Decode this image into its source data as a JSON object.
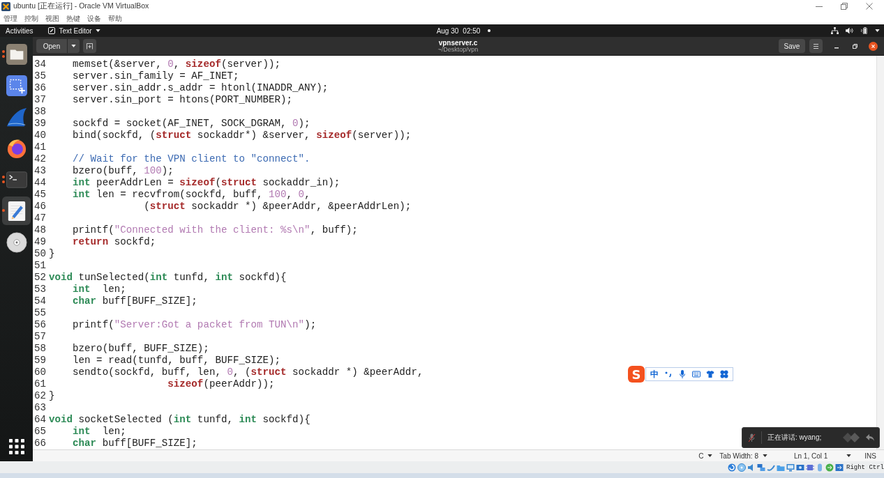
{
  "window": {
    "title": "ubuntu [正在运行] - Oracle VM VirtualBox"
  },
  "menu": [
    "管理",
    "控制",
    "视图",
    "热键",
    "设备",
    "帮助"
  ],
  "top_bar": {
    "activities": "Activities",
    "app_menu": "Text Editor",
    "date": "Aug 30",
    "time": "02:50",
    "unread_notification": true
  },
  "dock": {
    "items": [
      {
        "kind": "files",
        "running": true,
        "multiple_windows": true,
        "selected": false
      },
      {
        "kind": "screenshot",
        "running": false,
        "multiple_windows": false,
        "selected": false
      },
      {
        "kind": "wireshark",
        "running": false,
        "multiple_windows": false,
        "selected": false
      },
      {
        "kind": "firefox",
        "running": false,
        "multiple_windows": false,
        "selected": false
      },
      {
        "kind": "terminal",
        "running": true,
        "multiple_windows": true,
        "selected": false
      },
      {
        "kind": "editor",
        "running": true,
        "multiple_windows": false,
        "selected": true
      },
      {
        "kind": "disc",
        "running": false,
        "multiple_windows": false,
        "selected": false
      }
    ]
  },
  "editor": {
    "open_button": "Open",
    "file_name": "vpnserver.c",
    "file_path": "~/Desktop/vpn",
    "save_button": "Save",
    "lines": [
      {
        "number": "34",
        "tokens": [
          {
            "kind": "plain",
            "text": "    memset(&server, "
          },
          {
            "kind": "number",
            "text": "0"
          },
          {
            "kind": "plain",
            "text": ", "
          },
          {
            "kind": "keyword",
            "text": "sizeof"
          },
          {
            "kind": "plain",
            "text": "(server));"
          }
        ]
      },
      {
        "number": "35",
        "tokens": [
          {
            "kind": "plain",
            "text": "    server.sin_family = AF_INET;"
          }
        ]
      },
      {
        "number": "36",
        "tokens": [
          {
            "kind": "plain",
            "text": "    server.sin_addr.s_addr = htonl(INADDR_ANY);"
          }
        ]
      },
      {
        "number": "37",
        "tokens": [
          {
            "kind": "plain",
            "text": "    server.sin_port = htons(PORT_NUMBER);"
          }
        ]
      },
      {
        "number": "38"
      },
      {
        "number": "39",
        "tokens": [
          {
            "kind": "plain",
            "text": "    sockfd = socket(AF_INET, SOCK_DGRAM, "
          },
          {
            "kind": "number",
            "text": "0"
          },
          {
            "kind": "plain",
            "text": ");"
          }
        ]
      },
      {
        "number": "40",
        "tokens": [
          {
            "kind": "plain",
            "text": "    bind(sockfd, ("
          },
          {
            "kind": "keyword",
            "text": "struct"
          },
          {
            "kind": "plain",
            "text": " sockaddr*) &server, "
          },
          {
            "kind": "keyword",
            "text": "sizeof"
          },
          {
            "kind": "plain",
            "text": "(server));"
          }
        ]
      },
      {
        "number": "41"
      },
      {
        "number": "42",
        "tokens": [
          {
            "kind": "comment",
            "text": "    // Wait for the VPN client to \"connect\"."
          }
        ]
      },
      {
        "number": "43",
        "tokens": [
          {
            "kind": "plain",
            "text": "    bzero(buff, "
          },
          {
            "kind": "number",
            "text": "100"
          },
          {
            "kind": "plain",
            "text": ");"
          }
        ]
      },
      {
        "number": "44",
        "tokens": [
          {
            "kind": "type",
            "text": "    int"
          },
          {
            "kind": "plain",
            "text": " peerAddrLen = "
          },
          {
            "kind": "keyword",
            "text": "sizeof"
          },
          {
            "kind": "plain",
            "text": "("
          },
          {
            "kind": "keyword",
            "text": "struct"
          },
          {
            "kind": "plain",
            "text": " sockaddr_in);"
          }
        ]
      },
      {
        "number": "45",
        "tokens": [
          {
            "kind": "type",
            "text": "    int"
          },
          {
            "kind": "plain",
            "text": " len = recvfrom(sockfd, buff, "
          },
          {
            "kind": "number",
            "text": "100"
          },
          {
            "kind": "plain",
            "text": ", "
          },
          {
            "kind": "number",
            "text": "0"
          },
          {
            "kind": "plain",
            "text": ","
          }
        ]
      },
      {
        "number": "46",
        "tokens": [
          {
            "kind": "plain",
            "text": "                ("
          },
          {
            "kind": "keyword",
            "text": "struct"
          },
          {
            "kind": "plain",
            "text": " sockaddr *) &peerAddr, &peerAddrLen);"
          }
        ]
      },
      {
        "number": "47"
      },
      {
        "number": "48",
        "tokens": [
          {
            "kind": "plain",
            "text": "    printf("
          },
          {
            "kind": "string",
            "text": "\"Connected with the client: %s\\n\""
          },
          {
            "kind": "plain",
            "text": ", buff);"
          }
        ]
      },
      {
        "number": "49",
        "tokens": [
          {
            "kind": "keyword",
            "text": "    return"
          },
          {
            "kind": "plain",
            "text": " sockfd;"
          }
        ]
      },
      {
        "number": "50",
        "tokens": [
          {
            "kind": "plain",
            "text": "}"
          }
        ]
      },
      {
        "number": "51"
      },
      {
        "number": "52",
        "tokens": [
          {
            "kind": "type",
            "text": "void"
          },
          {
            "kind": "plain",
            "text": " tunSelected("
          },
          {
            "kind": "type",
            "text": "int"
          },
          {
            "kind": "plain",
            "text": " tunfd, "
          },
          {
            "kind": "type",
            "text": "int"
          },
          {
            "kind": "plain",
            "text": " sockfd){"
          }
        ]
      },
      {
        "number": "53",
        "tokens": [
          {
            "kind": "type",
            "text": "    int"
          },
          {
            "kind": "plain",
            "text": "  len;"
          }
        ]
      },
      {
        "number": "54",
        "tokens": [
          {
            "kind": "type",
            "text": "    char"
          },
          {
            "kind": "plain",
            "text": " buff[BUFF_SIZE];"
          }
        ]
      },
      {
        "number": "55"
      },
      {
        "number": "56",
        "tokens": [
          {
            "kind": "plain",
            "text": "    printf("
          },
          {
            "kind": "string",
            "text": "\"Server:Got a packet from TUN\\n\""
          },
          {
            "kind": "plain",
            "text": ");"
          }
        ]
      },
      {
        "number": "57"
      },
      {
        "number": "58",
        "tokens": [
          {
            "kind": "plain",
            "text": "    bzero(buff, BUFF_SIZE);"
          }
        ]
      },
      {
        "number": "59",
        "tokens": [
          {
            "kind": "plain",
            "text": "    len = read(tunfd, buff, BUFF_SIZE);"
          }
        ]
      },
      {
        "number": "60",
        "tokens": [
          {
            "kind": "plain",
            "text": "    sendto(sockfd, buff, len, "
          },
          {
            "kind": "number",
            "text": "0"
          },
          {
            "kind": "plain",
            "text": ", ("
          },
          {
            "kind": "keyword",
            "text": "struct"
          },
          {
            "kind": "plain",
            "text": " sockaddr *) &peerAddr,"
          }
        ]
      },
      {
        "number": "61",
        "tokens": [
          {
            "kind": "keyword",
            "text": "                    sizeof"
          },
          {
            "kind": "plain",
            "text": "(peerAddr));"
          }
        ]
      },
      {
        "number": "62",
        "tokens": [
          {
            "kind": "plain",
            "text": "}"
          }
        ]
      },
      {
        "number": "63"
      },
      {
        "number": "64",
        "tokens": [
          {
            "kind": "type",
            "text": "void"
          },
          {
            "kind": "plain",
            "text": " socketSelected ("
          },
          {
            "kind": "type",
            "text": "int"
          },
          {
            "kind": "plain",
            "text": " tunfd, "
          },
          {
            "kind": "type",
            "text": "int"
          },
          {
            "kind": "plain",
            "text": " sockfd){"
          }
        ]
      },
      {
        "number": "65",
        "tokens": [
          {
            "kind": "type",
            "text": "    int"
          },
          {
            "kind": "plain",
            "text": "  len;"
          }
        ]
      },
      {
        "number": "66",
        "tokens": [
          {
            "kind": "type",
            "text": "    char"
          },
          {
            "kind": "plain",
            "text": " buff[BUFF_SIZE];"
          }
        ]
      }
    ],
    "status_bar": {
      "language": "C",
      "tab_width": "Tab Width: 8",
      "position": "Ln 1, Col 1",
      "mode": "INS"
    }
  },
  "ime_toolbar": {
    "logo": "S",
    "mode": "中"
  },
  "notification": {
    "text": "正在讲话: wyang;"
  },
  "vm_status_bar": {
    "host_key": "Right Ctrl"
  }
}
